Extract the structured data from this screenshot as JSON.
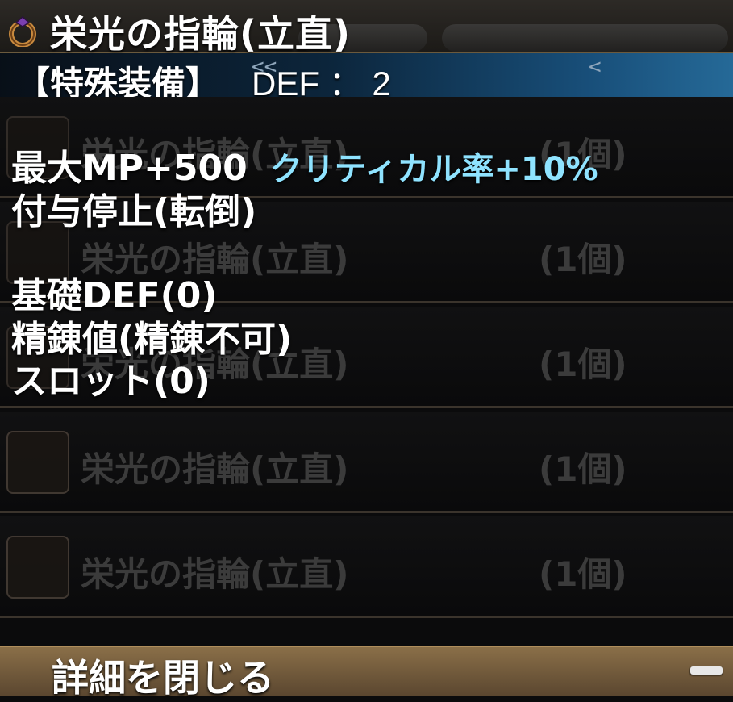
{
  "header": {
    "title": "栄光の指輪(立直)",
    "icon": "ring-icon"
  },
  "special": {
    "label": "【特殊装備】",
    "def": "DEF ： 2",
    "chevron_left": "<<",
    "chevron_right": "<"
  },
  "details": {
    "line1_main": "最大MP+500",
    "line1_crit": "クリティカル率+10%",
    "line2": "付与停止(転倒)",
    "line3": "基礎DEF(0)",
    "line4": "精錬値(精錬不可)",
    "line5": "スロット(0)"
  },
  "list": {
    "items": [
      {
        "name": "栄光の指輪(立直)",
        "qty": "(1個)"
      },
      {
        "name": "栄光の指輪(立直)",
        "qty": "(1個)"
      },
      {
        "name": "栄光の指輪(立直)",
        "qty": "(1個)"
      },
      {
        "name": "栄光の指輪(立直)",
        "qty": "(1個)"
      },
      {
        "name": "栄光の指輪(立直)",
        "qty": "(1個)"
      }
    ]
  },
  "footer": {
    "close_label": "詳細を閉じる",
    "collapse_icon": "minus-icon"
  },
  "colors": {
    "accent_crit": "#8fe3ff",
    "bar_brown": "#8a6f48"
  }
}
